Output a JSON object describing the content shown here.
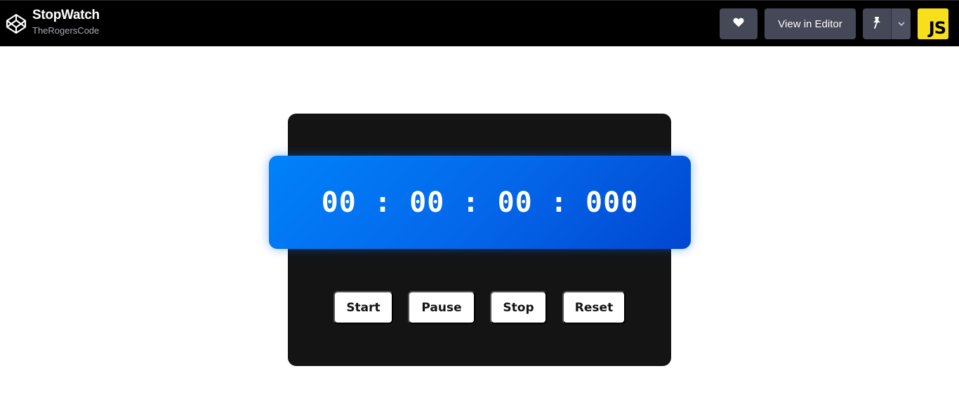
{
  "header": {
    "pen_title": "StopWatch",
    "author": "TheRogersCode",
    "logo_icon": "codepen-logo-icon",
    "heart_icon": "heart-icon",
    "view_in_editor_label": "View in Editor",
    "pin_icon": "pin-icon",
    "dropdown_icon": "chevron-down-icon",
    "js_badge_label": "JS",
    "colors": {
      "bar": "#000000",
      "button": "#444857",
      "js_badge": "#f7df1e"
    }
  },
  "stopwatch": {
    "time": {
      "hours": "00",
      "minutes": "00",
      "seconds": "00",
      "milliseconds": "000",
      "separator": ":"
    },
    "buttons": {
      "start": "Start",
      "pause": "Pause",
      "stop": "Stop",
      "reset": "Reset"
    },
    "colors": {
      "card": "#141414",
      "display_gradient_start": "#0082fa",
      "display_gradient_end": "#0147d1",
      "button": "#ffffff"
    }
  }
}
